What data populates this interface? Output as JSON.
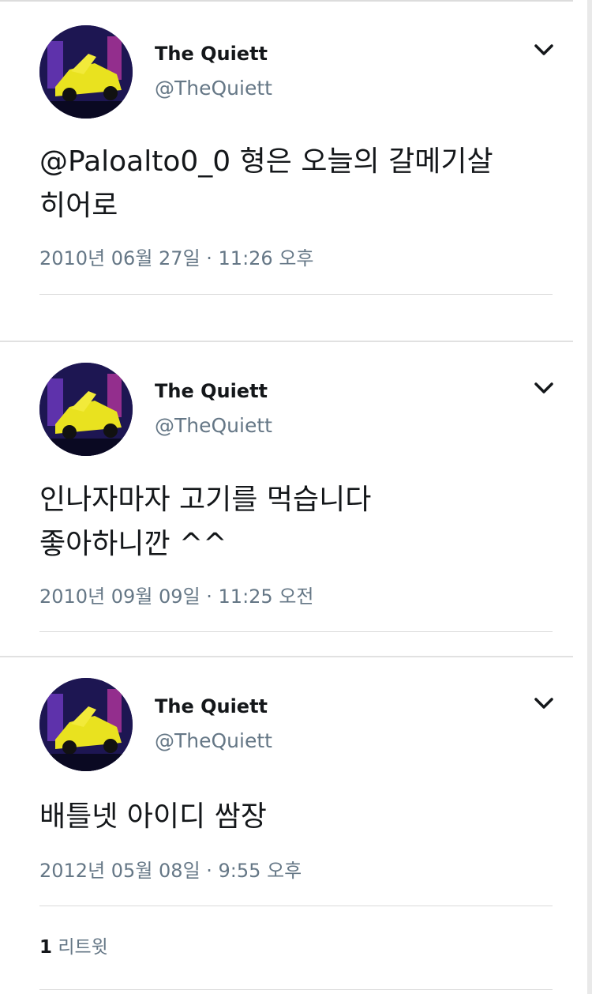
{
  "tweets": [
    {
      "name": "The Quiett",
      "handle": "@TheQuiett",
      "text_lines": [
        "@Paloalto0_0 형은 오늘의 갈메기살",
        "히어로"
      ],
      "timestamp": "2010년 06월 27일 · 11:26 오후"
    },
    {
      "name": "The Quiett",
      "handle": "@TheQuiett",
      "text_lines": [
        "인나자마자 고기를 먹습니다",
        "좋아하니깐 ^^"
      ],
      "timestamp": "2010년 09월 09일 · 11:25 오전"
    },
    {
      "name": "The Quiett",
      "handle": "@TheQuiett",
      "text_lines": [
        "배틀넷 아이디 쌈장"
      ],
      "timestamp": "2012년 05월 08일 · 9:55 오후",
      "retweet_count": "1",
      "retweet_label": "리트윗"
    }
  ],
  "icons": {
    "menu": "chevron-down-icon",
    "avatar": "profile-avatar"
  },
  "colors": {
    "name": "#14171a",
    "meta": "#657786",
    "divider": "#e1e1e1"
  }
}
